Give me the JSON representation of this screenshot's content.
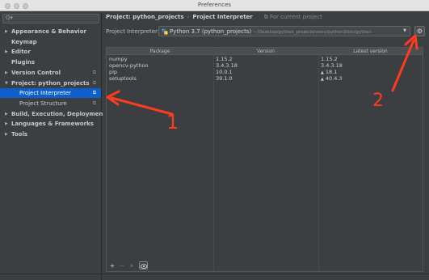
{
  "window": {
    "title": "Preferences"
  },
  "sidebar": {
    "search_placeholder": "",
    "items": [
      {
        "label": "Appearance & Behavior",
        "has_arrow": true,
        "arrow": "▶"
      },
      {
        "label": "Keymap",
        "has_arrow": false
      },
      {
        "label": "Editor",
        "has_arrow": true,
        "arrow": "▶"
      },
      {
        "label": "Plugins",
        "has_arrow": false
      },
      {
        "label": "Version Control",
        "has_arrow": true,
        "arrow": "▶",
        "config_icon": true
      },
      {
        "label": "Project: python_projects",
        "has_arrow": true,
        "arrow": "▼",
        "config_icon": true
      },
      {
        "label": "Project Interpreter",
        "child": true,
        "selected": true,
        "config_icon": true
      },
      {
        "label": "Project Structure",
        "child": true,
        "config_icon": true
      },
      {
        "label": "Build, Execution, Deployment",
        "has_arrow": true,
        "arrow": "▶"
      },
      {
        "label": "Languages & Frameworks",
        "has_arrow": true,
        "arrow": "▶"
      },
      {
        "label": "Tools",
        "has_arrow": true,
        "arrow": "▶"
      }
    ]
  },
  "breadcrumb": {
    "project": "Project: python_projects",
    "separator": "›",
    "page": "Project Interpreter",
    "scope": "For current project"
  },
  "interpreter": {
    "label": "Project Interpreter:",
    "value": "Python 3.7 (python_projects)",
    "path": "~/Desktop/python_projects/venv/python3/bin/python"
  },
  "packages": {
    "columns": [
      "Package",
      "Version",
      "Latest version"
    ],
    "rows": [
      {
        "package": "numpy",
        "version": "1.15.2",
        "latest": "1.15.2",
        "upgrade": false
      },
      {
        "package": "opencv-python",
        "version": "3.4.3.18",
        "latest": "3.4.3.18",
        "upgrade": false
      },
      {
        "package": "pip",
        "version": "10.0.1",
        "latest": "18.1",
        "upgrade": true
      },
      {
        "package": "setuptools",
        "version": "39.1.0",
        "latest": "40.4.3",
        "upgrade": true
      }
    ],
    "upgrade_glyph": "▲"
  },
  "toolbar": {
    "add": "+",
    "remove": "−",
    "upgrade": "▲"
  },
  "annotations": {
    "one": "1",
    "two": "2",
    "color": "#ff3b1f"
  },
  "colors": {
    "selection": "#0d5fce",
    "panel": "#3c3f41"
  }
}
